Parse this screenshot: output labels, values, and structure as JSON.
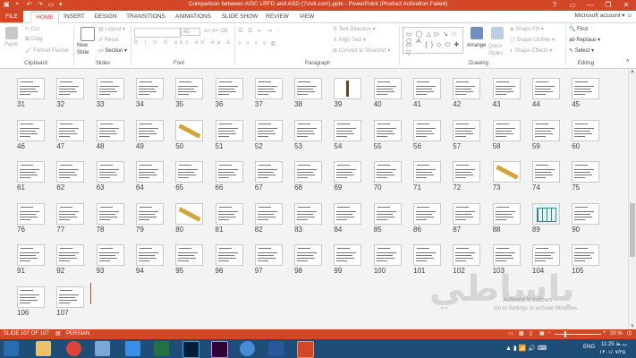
{
  "window": {
    "title": "Comparison between AISC LRFD and ASD (7civil.com).pptx - PowerPoint (Product Activation Failed)",
    "help": "?",
    "minimize": "—",
    "restore": "❐",
    "close": "✕"
  },
  "tabs": [
    "FILE",
    "HOME",
    "INSERT",
    "DESIGN",
    "TRANSITIONS",
    "ANIMATIONS",
    "SLIDE SHOW",
    "REVIEW",
    "VIEW"
  ],
  "account": "Microsoft account",
  "ribbon": {
    "clipboard": {
      "paste": "Paste",
      "cut": "Cut",
      "copy": "Copy",
      "format_painter": "Format Painter",
      "label": "Clipboard"
    },
    "slides": {
      "new_slide": "New Slide",
      "layout": "Layout",
      "reset": "Reset",
      "section": "Section",
      "label": "Slides"
    },
    "font": {
      "size": "40",
      "label": "Font"
    },
    "paragraph": {
      "text_direction": "Text Direction",
      "align_text": "Align Text",
      "convert": "Convert to SmartArt",
      "label": "Paragraph"
    },
    "drawing": {
      "arrange": "Arrange",
      "quick_styles": "Quick Styles",
      "shape_fill": "Shape Fill",
      "shape_outline": "Shape Outline",
      "shape_effects": "Shape Effects",
      "label": "Drawing"
    },
    "editing": {
      "find": "Find",
      "replace": "Replace",
      "select": "Select",
      "label": "Editing"
    }
  },
  "slides": [
    {
      "n": "31",
      "kind": "text"
    },
    {
      "n": "32",
      "kind": "text"
    },
    {
      "n": "33",
      "kind": "text"
    },
    {
      "n": "34",
      "kind": "text"
    },
    {
      "n": "35",
      "kind": "text"
    },
    {
      "n": "36",
      "kind": "text"
    },
    {
      "n": "37",
      "kind": "text"
    },
    {
      "n": "38",
      "kind": "text"
    },
    {
      "n": "39",
      "kind": "beam"
    },
    {
      "n": "40",
      "kind": "text"
    },
    {
      "n": "41",
      "kind": "text"
    },
    {
      "n": "42",
      "kind": "text"
    },
    {
      "n": "43",
      "kind": "text"
    },
    {
      "n": "44",
      "kind": "text"
    },
    {
      "n": "45",
      "kind": "text"
    },
    {
      "n": "46",
      "kind": "text"
    },
    {
      "n": "47",
      "kind": "text"
    },
    {
      "n": "48",
      "kind": "text"
    },
    {
      "n": "49",
      "kind": "text"
    },
    {
      "n": "50",
      "kind": "wood"
    },
    {
      "n": "51",
      "kind": "text"
    },
    {
      "n": "52",
      "kind": "text"
    },
    {
      "n": "53",
      "kind": "text"
    },
    {
      "n": "54",
      "kind": "text"
    },
    {
      "n": "55",
      "kind": "text"
    },
    {
      "n": "56",
      "kind": "text"
    },
    {
      "n": "57",
      "kind": "text"
    },
    {
      "n": "58",
      "kind": "text"
    },
    {
      "n": "59",
      "kind": "text"
    },
    {
      "n": "60",
      "kind": "text"
    },
    {
      "n": "61",
      "kind": "text"
    },
    {
      "n": "62",
      "kind": "text"
    },
    {
      "n": "63",
      "kind": "text"
    },
    {
      "n": "64",
      "kind": "text"
    },
    {
      "n": "65",
      "kind": "text"
    },
    {
      "n": "66",
      "kind": "text"
    },
    {
      "n": "67",
      "kind": "text"
    },
    {
      "n": "68",
      "kind": "text"
    },
    {
      "n": "69",
      "kind": "text"
    },
    {
      "n": "70",
      "kind": "text"
    },
    {
      "n": "71",
      "kind": "text"
    },
    {
      "n": "72",
      "kind": "text"
    },
    {
      "n": "73",
      "kind": "wood"
    },
    {
      "n": "74",
      "kind": "text"
    },
    {
      "n": "75",
      "kind": "text"
    },
    {
      "n": "76",
      "kind": "text"
    },
    {
      "n": "77",
      "kind": "text"
    },
    {
      "n": "78",
      "kind": "text"
    },
    {
      "n": "79",
      "kind": "text"
    },
    {
      "n": "80",
      "kind": "wood"
    },
    {
      "n": "81",
      "kind": "text"
    },
    {
      "n": "82",
      "kind": "text"
    },
    {
      "n": "83",
      "kind": "text"
    },
    {
      "n": "84",
      "kind": "text"
    },
    {
      "n": "85",
      "kind": "text"
    },
    {
      "n": "86",
      "kind": "text"
    },
    {
      "n": "87",
      "kind": "text"
    },
    {
      "n": "88",
      "kind": "text"
    },
    {
      "n": "89",
      "kind": "frame"
    },
    {
      "n": "90",
      "kind": "text"
    },
    {
      "n": "91",
      "kind": "text"
    },
    {
      "n": "92",
      "kind": "text"
    },
    {
      "n": "93",
      "kind": "text"
    },
    {
      "n": "94",
      "kind": "text"
    },
    {
      "n": "95",
      "kind": "text"
    },
    {
      "n": "96",
      "kind": "text"
    },
    {
      "n": "97",
      "kind": "text"
    },
    {
      "n": "98",
      "kind": "text"
    },
    {
      "n": "99",
      "kind": "text"
    },
    {
      "n": "100",
      "kind": "text"
    },
    {
      "n": "101",
      "kind": "text"
    },
    {
      "n": "102",
      "kind": "text"
    },
    {
      "n": "103",
      "kind": "text"
    },
    {
      "n": "104",
      "kind": "text"
    },
    {
      "n": "105",
      "kind": "text"
    },
    {
      "n": "106",
      "kind": "text"
    },
    {
      "n": "107",
      "kind": "text"
    }
  ],
  "watermark": {
    "logo_text": "باساطي",
    "activate1": "Activate Windows",
    "activate2": "Go to Settings to activate Windows."
  },
  "status": {
    "slide": "SLIDE 107 OF 107",
    "language": "PERSIAN",
    "zoom": "20 %"
  },
  "taskbar": {
    "lang": "ENG",
    "time": "11:25 ب.ظ",
    "date": "۱۴۰۱/۰۷/۲۵"
  },
  "colors": {
    "accent": "#d24726",
    "taskbar": "#1e4d78"
  }
}
